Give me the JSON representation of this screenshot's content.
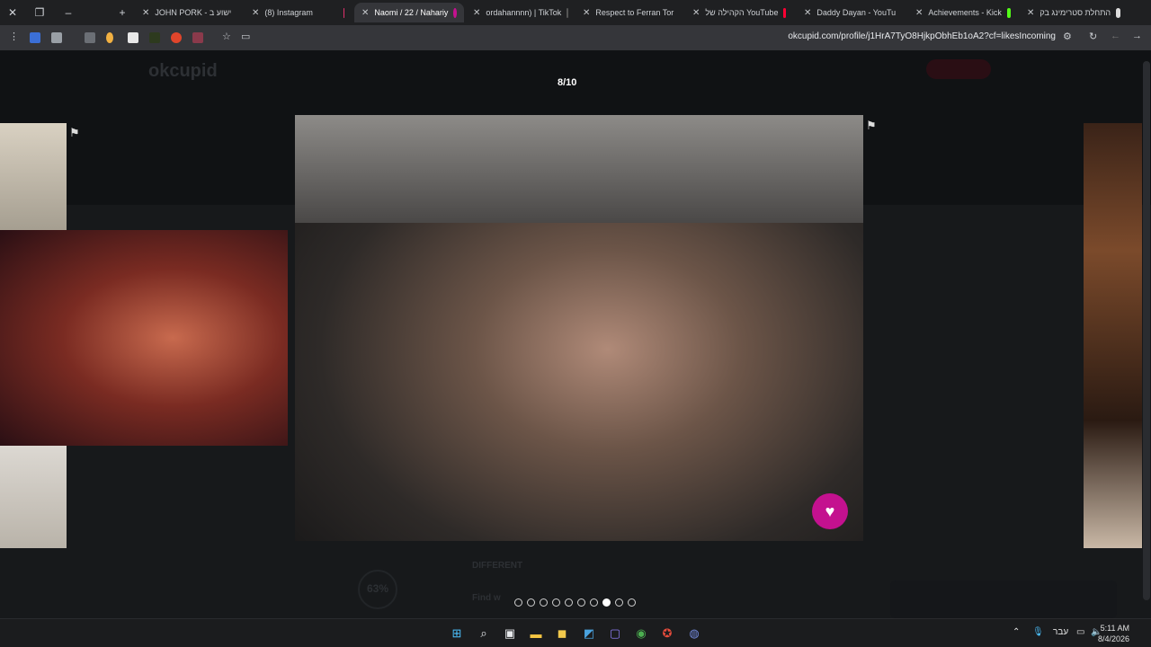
{
  "tabs": [
    {
      "title": "JOHN PORK - ישוע ב"
    },
    {
      "title": "(8) Instagram"
    },
    {
      "title": "Naomi / 22 / Nahariy"
    },
    {
      "title": "ordahannnn) | TikTok"
    },
    {
      "title": "Respect to Ferran Tor"
    },
    {
      "title": "הקהילה של YouTube"
    },
    {
      "title": "Daddy Dayan - YouTu"
    },
    {
      "title": "Achievements - Kick"
    },
    {
      "title": "התחלת סטרימינג בק"
    }
  ],
  "address_bar": {
    "url": "okcupid.com/profile/j1HrA7TyO8HjkpObhEb1oA2?cf=likesIncoming"
  },
  "background_page": {
    "logo": "okcupid",
    "section_label": "DIFFERENT",
    "match_percent": "63%",
    "find_label": "Find w"
  },
  "gallery": {
    "counter": "8/10",
    "total": 10,
    "current": 8
  },
  "taskbar": {
    "language": "עבר",
    "time": "5:11 AM",
    "date": "8/4/2026"
  },
  "colors": {
    "like_button": "#c4118f",
    "okcupid_red": "#e11d48"
  },
  "icons": [
    "close-icon",
    "new-tab-icon",
    "menu-icon",
    "star-icon",
    "flag-icon",
    "heart-icon",
    "windows-icon",
    "search-icon"
  ]
}
